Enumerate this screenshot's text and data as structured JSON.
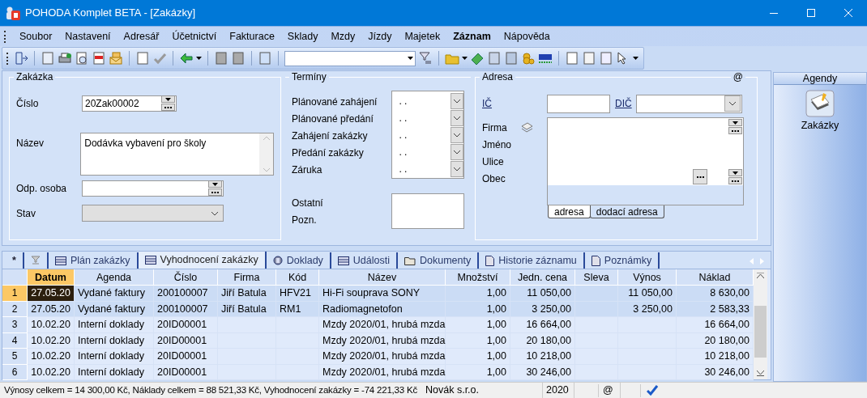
{
  "window": {
    "title": "POHODA Komplet BETA - [Zakázky]"
  },
  "menu": [
    {
      "label": "Soubor",
      "bold": false
    },
    {
      "label": "Nastavení",
      "bold": false
    },
    {
      "label": "Adresář",
      "bold": false
    },
    {
      "label": "Účetnictví",
      "bold": false
    },
    {
      "label": "Fakturace",
      "bold": false
    },
    {
      "label": "Sklady",
      "bold": false
    },
    {
      "label": "Mzdy",
      "bold": false
    },
    {
      "label": "Jízdy",
      "bold": false
    },
    {
      "label": "Majetek",
      "bold": false
    },
    {
      "label": "Záznam",
      "bold": true
    },
    {
      "label": "Nápověda",
      "bold": false
    }
  ],
  "order": {
    "title": "Zakázka",
    "fields": [
      {
        "label": "Číslo",
        "value": "20Zak00002",
        "kind": "picker"
      },
      {
        "label": "Název",
        "value": "Dodávka vybavení pro školy",
        "kind": "memo"
      },
      {
        "label": "Odp. osoba",
        "kind": "picker"
      },
      {
        "label": "Stav",
        "kind": "select",
        "disabled": true
      }
    ]
  },
  "terms": {
    "title": "Termíny",
    "dates": [
      {
        "label": "Plánované zahájení",
        "value": ". ."
      },
      {
        "label": "Plánované předání",
        "value": ". ."
      },
      {
        "label": "Zahájení zakázky",
        "value": ". ."
      },
      {
        "label": "Předání zakázky",
        "value": ". ."
      },
      {
        "label": "Záruka",
        "value": ". ."
      }
    ],
    "notes": [
      "Ostatní",
      "Pozn."
    ]
  },
  "address": {
    "title": "Adresa",
    "email_mark": "@",
    "ic_label": "IČ",
    "dic_label": "DIČ",
    "lines": [
      "Firma",
      "Jméno",
      "Ulice",
      "Obec"
    ],
    "tabs": [
      {
        "label": "adresa",
        "selected": true
      },
      {
        "label": "dodací adresa",
        "selected": false
      }
    ]
  },
  "detail_tabs": [
    {
      "kind": "text",
      "label": "*",
      "selected": false
    },
    {
      "kind": "filter",
      "selected": false
    },
    {
      "kind": "table",
      "label": "Plán zakázky",
      "selected": false
    },
    {
      "kind": "table",
      "label": "Vyhodnocení zakázky",
      "selected": true
    },
    {
      "kind": "disc",
      "label": "Doklady",
      "selected": false
    },
    {
      "kind": "table",
      "label": "Události",
      "selected": false
    },
    {
      "kind": "folder",
      "label": "Dokumenty",
      "selected": false
    },
    {
      "kind": "page",
      "label": "Historie záznamu",
      "selected": false
    },
    {
      "kind": "page",
      "label": "Poznámky",
      "selected": false
    }
  ],
  "table": {
    "columns": [
      {
        "label": "Datum",
        "numeric": true,
        "current": true
      },
      {
        "label": "Agenda",
        "numeric": false,
        "current": false
      },
      {
        "label": "Číslo",
        "numeric": false,
        "current": false
      },
      {
        "label": "Firma",
        "numeric": false,
        "current": false
      },
      {
        "label": "Kód",
        "numeric": false,
        "current": false
      },
      {
        "label": "Název",
        "numeric": false,
        "current": false
      },
      {
        "label": "Množství",
        "numeric": true,
        "current": false
      },
      {
        "label": "Jedn. cena",
        "numeric": true,
        "current": false
      },
      {
        "label": "Sleva",
        "current": false
      },
      {
        "label": "Výnos",
        "numeric": true,
        "current": false
      },
      {
        "label": "Náklad",
        "numeric": true,
        "current": false
      }
    ],
    "rows": [
      {
        "number": "1",
        "selected": true,
        "current": true,
        "cells": [
          "27.05.20",
          "Vydané faktury",
          "200100007",
          "Jiří Batula",
          "HFV21",
          "Hi-Fi souprava SONY",
          "1,00",
          "11 050,00",
          "",
          "11 050,00",
          "8 630,00"
        ]
      },
      {
        "number": "2",
        "selected": true,
        "current": false,
        "cells": [
          "27.05.20",
          "Vydané faktury",
          "200100007",
          "Jiří Batula",
          "RM1",
          "Radiomagnetofon",
          "1,00",
          "3 250,00",
          "",
          "3 250,00",
          "2 583,33"
        ]
      },
      {
        "number": "3",
        "selected": false,
        "current": false,
        "cells": [
          "10.02.20",
          "Interní doklady",
          "20ID00001",
          "",
          "",
          "Mzdy 2020/01, hrubá mzda",
          "1,00",
          "16 664,00",
          "",
          "",
          "16 664,00"
        ]
      },
      {
        "number": "4",
        "selected": false,
        "current": false,
        "cells": [
          "10.02.20",
          "Interní doklady",
          "20ID00001",
          "",
          "",
          "Mzdy 2020/01, hrubá mzda",
          "1,00",
          "20 180,00",
          "",
          "",
          "20 180,00"
        ]
      },
      {
        "number": "5",
        "selected": false,
        "current": false,
        "cells": [
          "10.02.20",
          "Interní doklady",
          "20ID00001",
          "",
          "",
          "Mzdy 2020/01, hrubá mzda",
          "1,00",
          "10 218,00",
          "",
          "",
          "10 218,00"
        ]
      },
      {
        "number": "6",
        "selected": false,
        "current": false,
        "cells": [
          "10.02.20",
          "Interní doklady",
          "20ID00001",
          "",
          "",
          "Mzdy 2020/01, hrubá mzda",
          "1,00",
          "30 246,00",
          "",
          "",
          "30 246,00"
        ]
      }
    ]
  },
  "sidebar": {
    "title": "Agendy",
    "items": [
      {
        "label": "Zakázky"
      }
    ]
  },
  "status_bar": {
    "summary": "Výnosy celkem = 14 300,00 Kč, Náklady celkem = 88 521,33 Kč, Vyhodnocení zakázky = -74 221,33 Kč",
    "company": "Novák s.r.o.",
    "year": "2020",
    "email": "@"
  }
}
